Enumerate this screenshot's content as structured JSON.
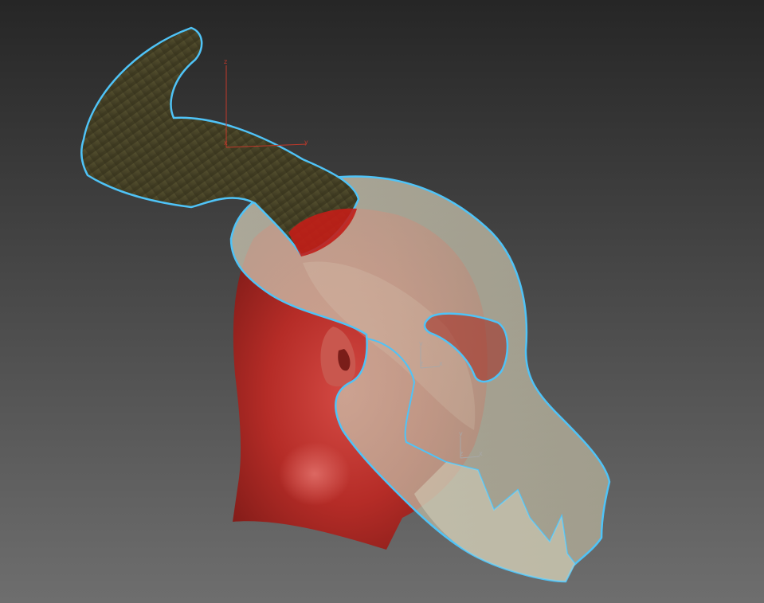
{
  "viewport": {
    "background_top": "#262626",
    "background_bottom": "#6c6c6c",
    "selection_outline": "#4fc3f7"
  },
  "world_gizmo": {
    "z_label": "z",
    "x_label": "x",
    "y_label": "y",
    "color": "#c0392b"
  },
  "pivot_gizmo_eye": {
    "y_label": "y",
    "z_label": "z",
    "x_label": "x",
    "color": "#9a9a9a"
  },
  "pivot_gizmo_mouth": {
    "y_label": "y",
    "z_label": "z",
    "x_label": "x",
    "color": "#9a9a9a"
  },
  "objects": [
    {
      "name": "head",
      "color": "#b02a26"
    },
    {
      "name": "horn",
      "color": "#4a4528"
    },
    {
      "name": "skull-mask",
      "color": "#c9c4ae"
    }
  ]
}
